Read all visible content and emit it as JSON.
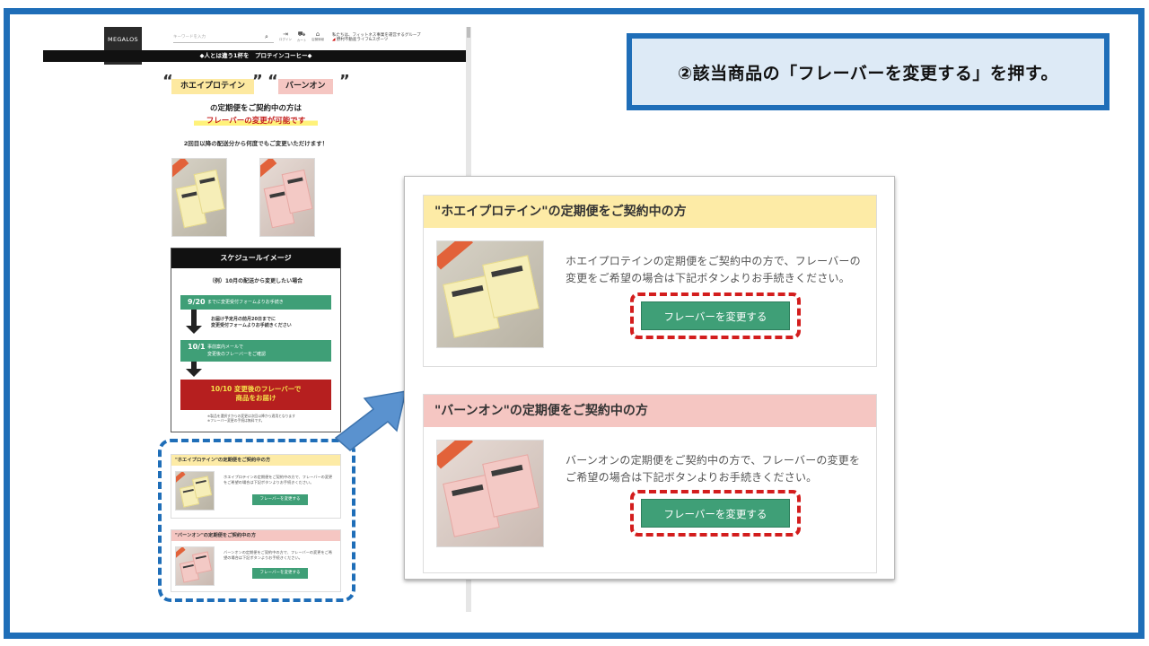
{
  "callout": {
    "text": "②該当商品の「フレーバーを変更する」を押す。"
  },
  "site": {
    "logo": "MEGALOS",
    "search_placeholder": "キーワードを入力",
    "header_icons": [
      {
        "name": "login",
        "label": "ログイン"
      },
      {
        "name": "cart",
        "label": "カート"
      },
      {
        "name": "store",
        "label": "店舗情報"
      }
    ],
    "brand_line1": "私たちは、フィットネス事業を運営するグループ",
    "brand_line2": "野村不動産ライフ&スポーツ",
    "top_banner": "◆人とは違う1杯を　プロテインコーヒー◆",
    "tag1": "ホエイプロテイン",
    "tag2": "バーンオン",
    "lead1": "の定期便をご契約中の方は",
    "lead2": "フレーバーの変更が可能です",
    "lead3": "2回目以降の配送分から何度でもご変更いただけます！",
    "schedule": {
      "title": "スケジュールイメージ",
      "example": "（例）10月の配送から変更したい場合",
      "step1_date": "9/20",
      "step1_text": "までに変更受付フォームよりお手続き",
      "note1_line1": "お届け予定月の前月20日までに",
      "note1_line2": "変更受付フォームよりお手続きください",
      "step2_date": "10/1",
      "step2_text1": "事前案内メールで",
      "step2_text2": "変更後のフレーバーをご確認",
      "final_line1": "10/10 変更後のフレーバーで",
      "final_line2": "商品をお届け",
      "foot1": "※製品を選択すからの変更は次回以降から適用となります",
      "foot2": "※フレーバー変更の手続は無料です。"
    }
  },
  "sections": [
    {
      "title": "\"ホエイプロテイン\"の定期便をご契約中の方",
      "text": "ホエイプロテインの定期便をご契約中の方で、フレーバーの変更をご希望の場合は下記ボタンよりお手続きください。",
      "button": "フレーバーを変更する",
      "color": "#fdeba6"
    },
    {
      "title": "\"バーンオン\"の定期便をご契約中の方",
      "text": "バーンオンの定期便をご契約中の方で、フレーバーの変更をご希望の場合は下記ボタンよりお手続きください。",
      "button": "フレーバーを変更する",
      "color": "#f5c6c2"
    }
  ],
  "colors": {
    "frame": "#1f6eb8",
    "button": "#3f9f77",
    "highlight": "#d31d1d"
  }
}
